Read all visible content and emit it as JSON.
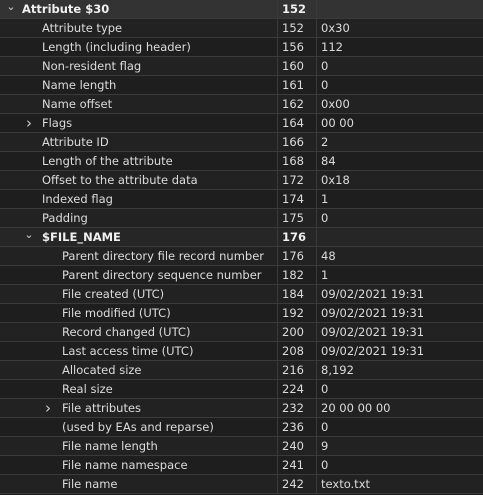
{
  "rows": [
    {
      "level": 0,
      "toggle": "expanded",
      "bold": true,
      "name": "Attribute $30",
      "offset": "152",
      "value": "",
      "style": "header"
    },
    {
      "level": 1,
      "toggle": "",
      "bold": false,
      "name": "Attribute type",
      "offset": "152",
      "value": "0x30",
      "style": ""
    },
    {
      "level": 1,
      "toggle": "",
      "bold": false,
      "name": "Length (including header)",
      "offset": "156",
      "value": "112",
      "style": ""
    },
    {
      "level": 1,
      "toggle": "",
      "bold": false,
      "name": "Non-resident flag",
      "offset": "160",
      "value": "0",
      "style": ""
    },
    {
      "level": 1,
      "toggle": "",
      "bold": false,
      "name": "Name length",
      "offset": "161",
      "value": "0",
      "style": ""
    },
    {
      "level": 1,
      "toggle": "",
      "bold": false,
      "name": "Name offset",
      "offset": "162",
      "value": "0x00",
      "style": ""
    },
    {
      "level": 1,
      "toggle": "collapsed",
      "bold": false,
      "name": "Flags",
      "offset": "164",
      "value": "00 00",
      "style": ""
    },
    {
      "level": 1,
      "toggle": "",
      "bold": false,
      "name": "Attribute ID",
      "offset": "166",
      "value": "2",
      "style": ""
    },
    {
      "level": 1,
      "toggle": "",
      "bold": false,
      "name": "Length of the attribute",
      "offset": "168",
      "value": "84",
      "style": ""
    },
    {
      "level": 1,
      "toggle": "",
      "bold": false,
      "name": "Offset to the attribute data",
      "offset": "172",
      "value": "0x18",
      "style": ""
    },
    {
      "level": 1,
      "toggle": "",
      "bold": false,
      "name": "Indexed flag",
      "offset": "174",
      "value": "1",
      "style": ""
    },
    {
      "level": 1,
      "toggle": "",
      "bold": false,
      "name": "Padding",
      "offset": "175",
      "value": "0",
      "style": ""
    },
    {
      "level": 1,
      "toggle": "expanded",
      "bold": true,
      "name": "$FILE_NAME",
      "offset": "176",
      "value": "",
      "style": "section"
    },
    {
      "level": 2,
      "toggle": "",
      "bold": false,
      "name": "Parent directory file record number",
      "offset": "176",
      "value": "48",
      "style": ""
    },
    {
      "level": 2,
      "toggle": "",
      "bold": false,
      "name": "Parent directory sequence number",
      "offset": "182",
      "value": "1",
      "style": ""
    },
    {
      "level": 2,
      "toggle": "",
      "bold": false,
      "name": "File created (UTC)",
      "offset": "184",
      "value": "09/02/2021 19:31",
      "style": ""
    },
    {
      "level": 2,
      "toggle": "",
      "bold": false,
      "name": "File modified (UTC)",
      "offset": "192",
      "value": "09/02/2021 19:31",
      "style": ""
    },
    {
      "level": 2,
      "toggle": "",
      "bold": false,
      "name": "Record changed (UTC)",
      "offset": "200",
      "value": "09/02/2021 19:31",
      "style": ""
    },
    {
      "level": 2,
      "toggle": "",
      "bold": false,
      "name": "Last access time (UTC)",
      "offset": "208",
      "value": "09/02/2021 19:31",
      "style": ""
    },
    {
      "level": 2,
      "toggle": "",
      "bold": false,
      "name": "Allocated size",
      "offset": "216",
      "value": "8,192",
      "style": ""
    },
    {
      "level": 2,
      "toggle": "",
      "bold": false,
      "name": "Real size",
      "offset": "224",
      "value": "0",
      "style": ""
    },
    {
      "level": 2,
      "toggle": "collapsed",
      "bold": false,
      "name": "File attributes",
      "offset": "232",
      "value": "20 00 00 00",
      "style": ""
    },
    {
      "level": 2,
      "toggle": "",
      "bold": false,
      "name": "(used by EAs and reparse)",
      "offset": "236",
      "value": "0",
      "style": ""
    },
    {
      "level": 2,
      "toggle": "",
      "bold": false,
      "name": "File name length",
      "offset": "240",
      "value": "9",
      "style": ""
    },
    {
      "level": 2,
      "toggle": "",
      "bold": false,
      "name": "File name namespace",
      "offset": "241",
      "value": "0",
      "style": ""
    },
    {
      "level": 2,
      "toggle": "",
      "bold": false,
      "name": "File name",
      "offset": "242",
      "value": "texto.txt",
      "style": ""
    }
  ],
  "icons": {
    "expanded": "chevron-down-icon",
    "collapsed": "chevron-right-icon"
  }
}
